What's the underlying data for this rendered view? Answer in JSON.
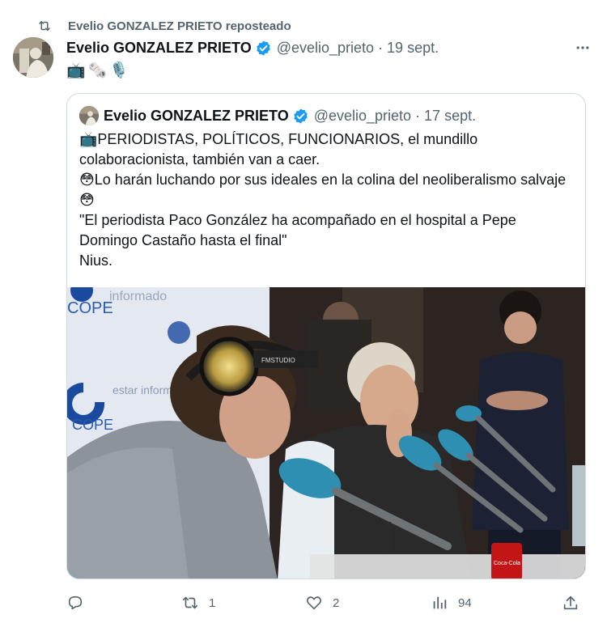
{
  "repost": {
    "label": "Evelio GONZALEZ PRIETO reposteado"
  },
  "tweet": {
    "author_name": "Evelio GONZALEZ PRIETO",
    "handle": "@evelio_prieto",
    "separator": "·",
    "time": "19 sept.",
    "emojis": [
      "📺",
      "🗞️",
      "🎙️"
    ]
  },
  "quote": {
    "author_name": "Evelio GONZALEZ PRIETO",
    "handle": "@evelio_prieto",
    "separator": "·",
    "time": "17 sept.",
    "lines": [
      "📺PERIODISTAS, POLÍTICOS, FUNCIONARIOS, el mundillo colaboracionista, también van a caer.",
      "😳Lo harán luchando por sus ideales en la colina del neoliberalismo salvaje😳",
      "\"El periodista Paco González ha acompañado en el hospital a Pepe Domingo Castaño hasta el final\"",
      "Nius."
    ],
    "media_text": {
      "cope_top": "COPE",
      "informado_top": "informado",
      "cope_mid": "COPE",
      "estar_informado": "estar informado",
      "headphones": "FMSTUDIO",
      "can_label": "Coca-Cola"
    }
  },
  "actions": {
    "reply_count": "",
    "repost_count": "1",
    "like_count": "2",
    "views_count": "94"
  },
  "colors": {
    "text": "#0f1419",
    "secondary": "#536471",
    "verified": "#1d9bf0",
    "border": "#cfd9de"
  },
  "icons": [
    "repost-icon",
    "verified-badge-icon",
    "more-icon",
    "reply-icon",
    "like-icon",
    "views-icon",
    "share-icon"
  ]
}
